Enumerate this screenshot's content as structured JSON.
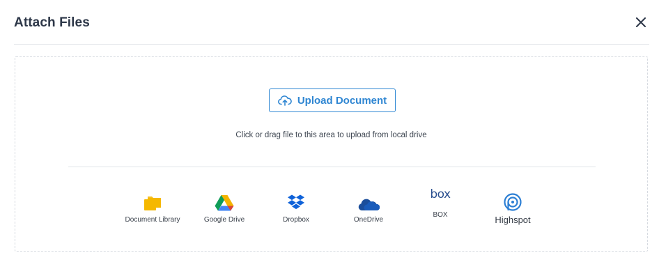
{
  "modal": {
    "title": "Attach Files",
    "close_icon": "close-icon"
  },
  "upload": {
    "button_label": "Upload Document",
    "icon": "cloud-upload-icon",
    "hint": "Click or drag file to this area to upload from local drive"
  },
  "sources": [
    {
      "label": "Document Library",
      "icon": "folder-icon"
    },
    {
      "label": "Google Drive",
      "icon": "google-drive-icon"
    },
    {
      "label": "Dropbox",
      "icon": "dropbox-icon"
    },
    {
      "label": "OneDrive",
      "icon": "onedrive-icon"
    },
    {
      "label": "BOX",
      "icon": "box-icon",
      "logo_text": "box"
    },
    {
      "label": "Highspot",
      "icon": "highspot-icon"
    }
  ],
  "colors": {
    "accent": "#2f86d2",
    "folder": "#f5b800",
    "dropbox": "#0f62d9",
    "onedrive": "#1b4e9b",
    "highspot": "#2d7fd4"
  }
}
